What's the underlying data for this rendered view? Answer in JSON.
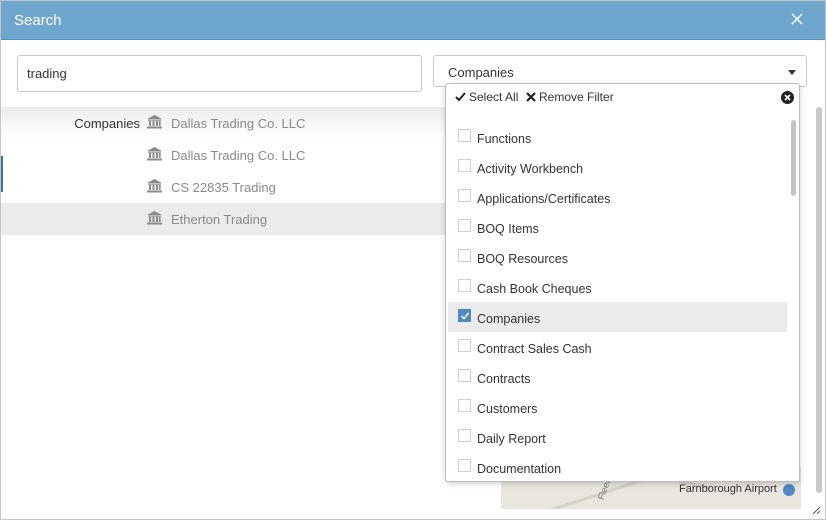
{
  "dialog": {
    "title": "Search",
    "close_icon": "close-icon"
  },
  "search": {
    "value": "trading",
    "placeholder": ""
  },
  "filter": {
    "selected": "Companies"
  },
  "results": [
    {
      "group": "Companies",
      "name": "Dallas Trading Co. LLC",
      "icon": "bank-icon",
      "highlighted": false
    },
    {
      "group": "",
      "name": "Dallas Trading Co. LLC",
      "icon": "bank-icon",
      "highlighted": false
    },
    {
      "group": "",
      "name": "CS 22835 Trading",
      "icon": "bank-icon",
      "highlighted": false
    },
    {
      "group": "",
      "name": "Etherton Trading",
      "icon": "bank-icon",
      "highlighted": true
    }
  ],
  "dropdown": {
    "select_all": "Select All",
    "remove_filter": "Remove Filter",
    "items": [
      {
        "label": "Functions",
        "checked": false
      },
      {
        "label": "Activity Workbench",
        "checked": false
      },
      {
        "label": "Applications/Certificates",
        "checked": false
      },
      {
        "label": "BOQ Items",
        "checked": false
      },
      {
        "label": "BOQ Resources",
        "checked": false
      },
      {
        "label": "Cash Book Cheques",
        "checked": false
      },
      {
        "label": "Companies",
        "checked": true
      },
      {
        "label": "Contract Sales Cash",
        "checked": false
      },
      {
        "label": "Contracts",
        "checked": false
      },
      {
        "label": "Customers",
        "checked": false
      },
      {
        "label": "Daily Report",
        "checked": false
      },
      {
        "label": "Documentation",
        "checked": false
      }
    ]
  },
  "map": {
    "place_label": "Farnborough Airport",
    "street_label": "Fleet"
  },
  "colors": {
    "titlebar": "#6fa6cd",
    "checkbox_checked": "#4e8bc1",
    "highlight_row": "#ebebeb"
  }
}
